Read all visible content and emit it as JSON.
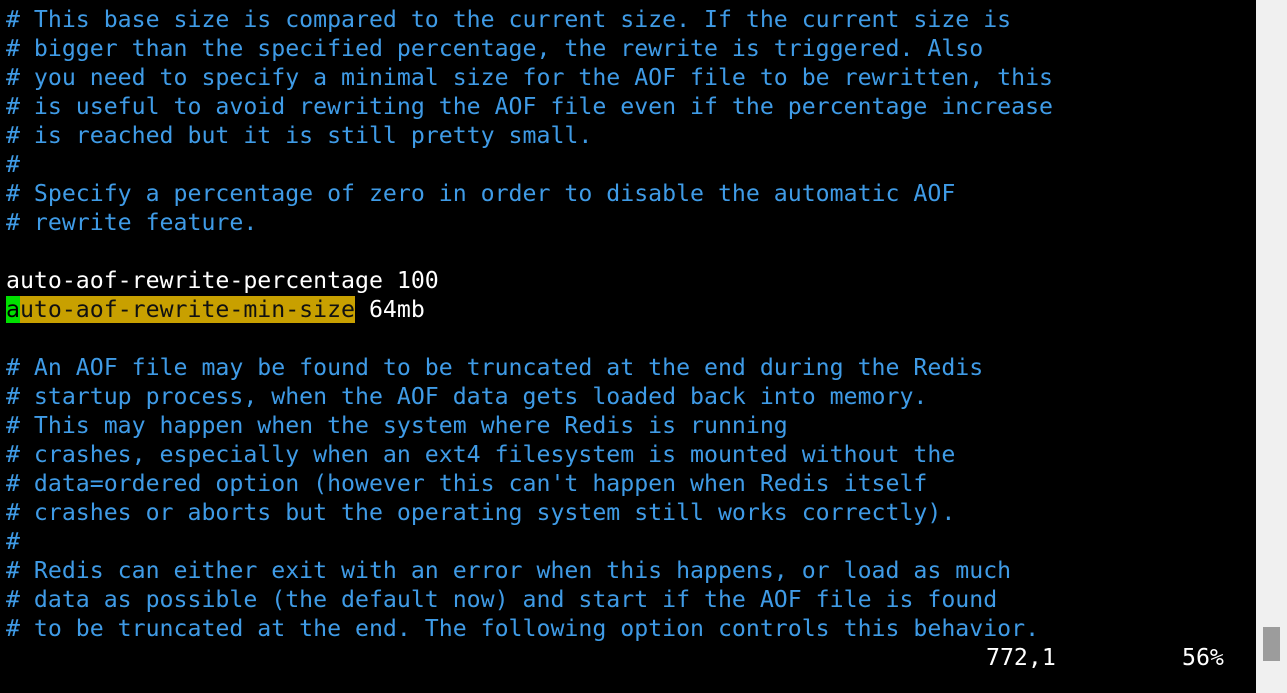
{
  "editor": {
    "lines": [
      "# This base size is compared to the current size. If the current size is",
      "# bigger than the specified percentage, the rewrite is triggered. Also",
      "# you need to specify a minimal size for the AOF file to be rewritten, this",
      "# is useful to avoid rewriting the AOF file even if the percentage increase",
      "# is reached but it is still pretty small.",
      "#",
      "# Specify a percentage of zero in order to disable the automatic AOF",
      "# rewrite feature.",
      "",
      "auto-aof-rewrite-percentage 100",
      "",
      "",
      "# An AOF file may be found to be truncated at the end during the Redis",
      "# startup process, when the AOF data gets loaded back into memory.",
      "# This may happen when the system where Redis is running",
      "# crashes, especially when an ext4 filesystem is mounted without the",
      "# data=ordered option (however this can't happen when Redis itself",
      "# crashes or aborts but the operating system still works correctly).",
      "#",
      "# Redis can either exit with an error when this happens, or load as much",
      "# data as possible (the default now) and start if the AOF file is found",
      "# to be truncated at the end. The following option controls this behavior."
    ],
    "cursor_line": {
      "cursor_char": "a",
      "highlighted_rest": "uto-aof-rewrite-min-size",
      "value": " 64mb"
    }
  },
  "status": {
    "position": "772,1",
    "percent": "56%"
  },
  "colors": {
    "comment": "#3f9be6",
    "text": "#ffffff",
    "background": "#000000",
    "search_highlight": "#c8a000",
    "cursor": "#00e000"
  }
}
